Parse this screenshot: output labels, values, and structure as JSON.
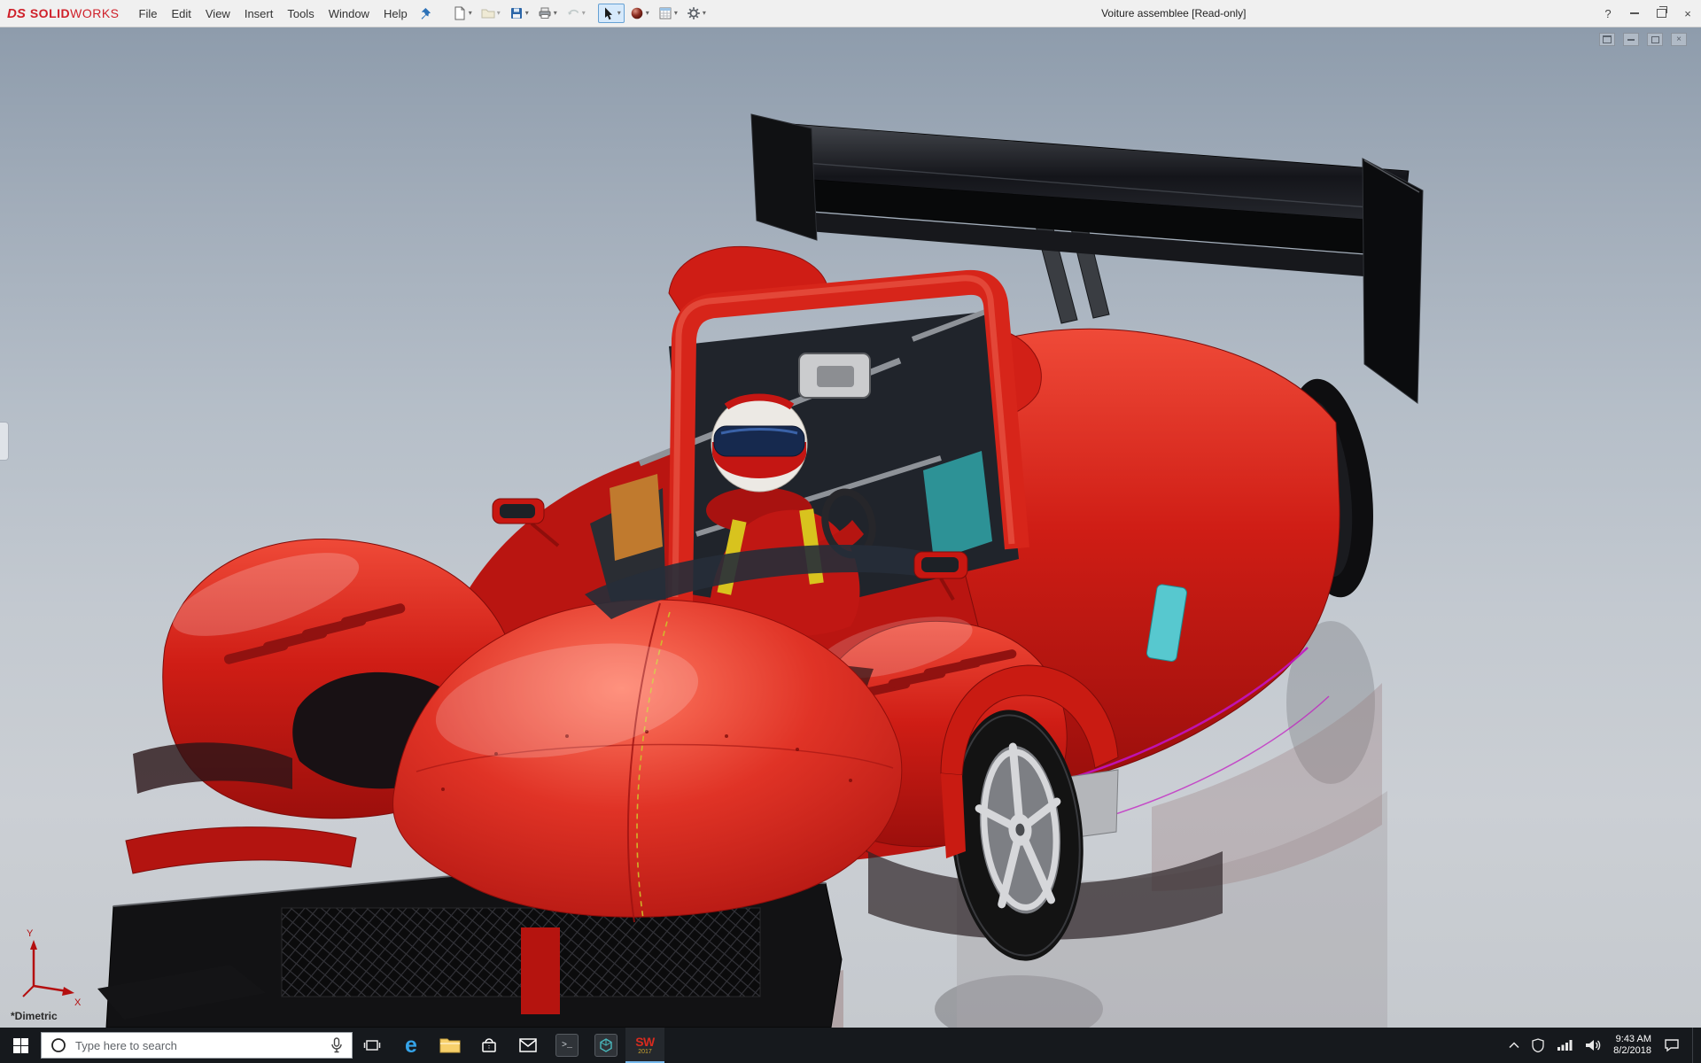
{
  "app": {
    "logo_text": "DS",
    "brand_solid": "SOLID",
    "brand_works": "WORKS",
    "title": "Voiture assemblee [Read-only]"
  },
  "menubar": {
    "items": [
      "File",
      "Edit",
      "View",
      "Insert",
      "Tools",
      "Window",
      "Help"
    ]
  },
  "window_controls": {
    "help": "?",
    "close": "×"
  },
  "viewport": {
    "orientation": "*Dimetric",
    "axis_x": "X",
    "axis_y": "Y"
  },
  "taskbar": {
    "search_placeholder": "Type here to search",
    "time": "9:43 AM",
    "date": "8/2/2018",
    "sw_label": "SW",
    "sw_year": "2017",
    "edge_letter": "e"
  },
  "icons": {
    "dropdown_caret": "▾",
    "dassault_logo": "DS monogram",
    "pushpin": "blue pushpin",
    "new_document": "page",
    "open_document": "folder",
    "save": "floppy-disk",
    "print": "printer",
    "undo": "curved-arrow",
    "select_cursor": "arrow-cursor",
    "appearance_sphere": "red-sphere",
    "evaluate_sheet": "grid-sheet",
    "options_gear": "gear",
    "start": "windows-logo",
    "cortana": "circle",
    "microphone": "mic",
    "task_view": "stacked-rects",
    "file_explorer": "yellow-folder",
    "store": "shopping-bag",
    "mail": "envelope",
    "terminal": "dark-tile",
    "viewer3d": "cube-tile",
    "network": "wifi",
    "volume": "speaker",
    "action_center": "speech-bubble"
  },
  "colors": {
    "brand": "#cf202a",
    "body_red": "#cf1d15",
    "taskbar": "#16191d",
    "selection": "#d6e9fb",
    "magenta_edge": "#c213c2",
    "teal": "#2d9296"
  }
}
